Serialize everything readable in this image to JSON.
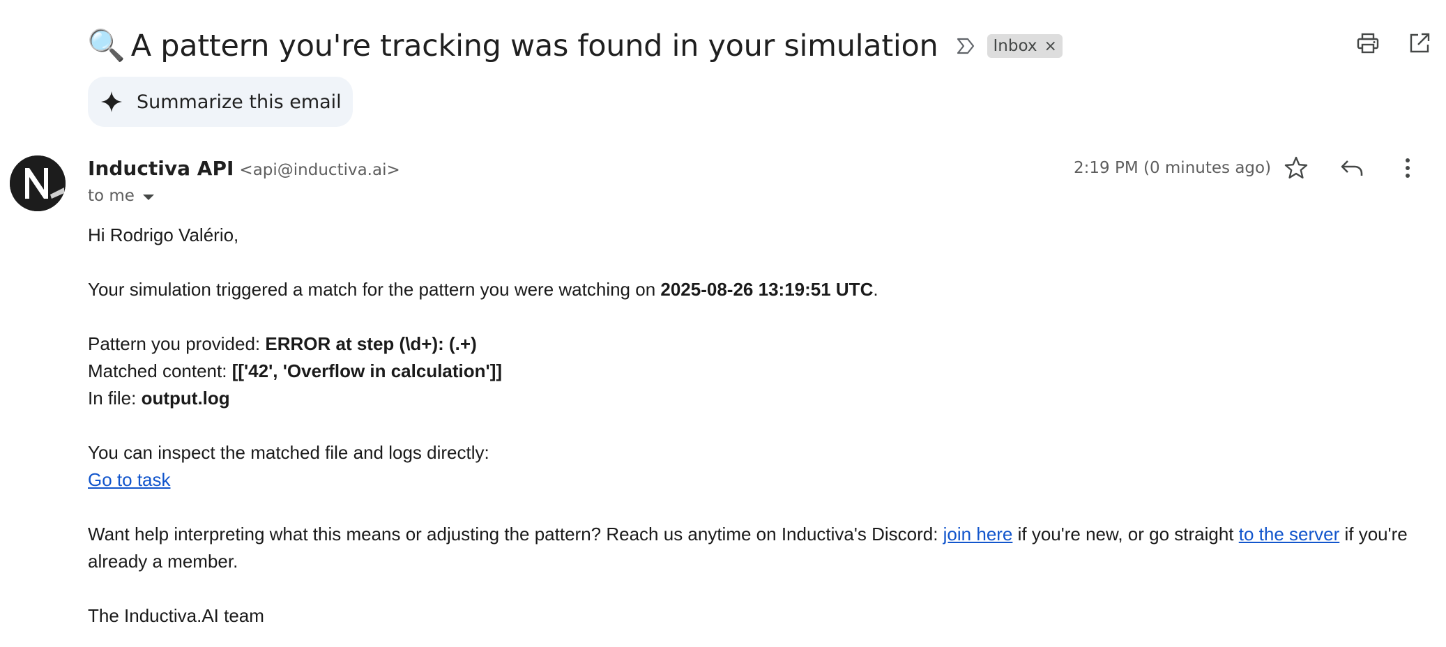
{
  "subject": {
    "emoji": "🔍",
    "title": "A pattern you're tracking was found in your simulation",
    "label": "Inbox",
    "label_close": "×"
  },
  "toolbar": {
    "icons": [
      "print-icon",
      "open-in-new-window-icon"
    ]
  },
  "summarize": {
    "label": "Summarize this email"
  },
  "sender": {
    "name": "Inductiva API",
    "email": "<api@inductiva.ai>",
    "to": "to me",
    "timestamp": "2:19 PM (0 minutes ago)"
  },
  "message_actions": {
    "icons": [
      "star-icon",
      "reply-icon",
      "more-vert-icon"
    ]
  },
  "body": {
    "greeting": "Hi Rodrigo Valério,",
    "intro_prefix": "Your simulation triggered a match for the pattern you were watching on ",
    "intro_time": "2025-08-26 13:19:51 UTC",
    "intro_suffix": ".",
    "pattern_label": "Pattern you provided: ",
    "pattern_value": "ERROR at step (\\d+): (.+)",
    "matched_label": "Matched content: ",
    "matched_value": "[['42', 'Overflow in calculation']]",
    "file_label": "In file: ",
    "file_value": "output.log",
    "inspect_text": "You can inspect the matched file and logs directly:",
    "go_to_task_link": "Go to task",
    "help_prefix": "Want help interpreting what this means or adjusting the pattern? Reach us anytime on Inductiva's Discord: ",
    "join_link": "join here",
    "help_middle": " if you're new, or go straight ",
    "server_link": "to the server",
    "help_suffix": " if you're already a member.",
    "signoff": "The Inductiva.AI team"
  },
  "colors": {
    "link": "#1155cc",
    "chip_bg": "#dddddd",
    "summarize_bg": "#f0f4f9",
    "secondary_text": "#5e5e5e"
  }
}
